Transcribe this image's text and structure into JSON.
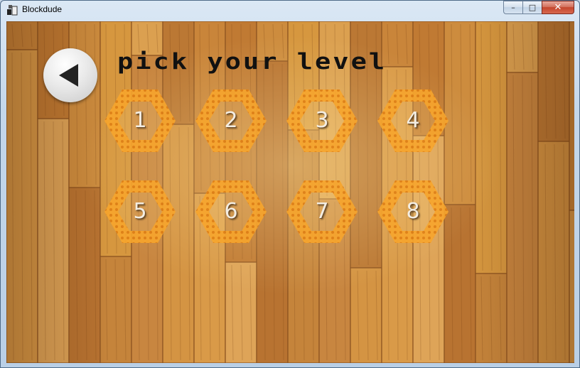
{
  "window": {
    "title": "Blockdude",
    "minimize_glyph": "–",
    "maximize_glyph": "□",
    "close_glyph": "✕"
  },
  "game": {
    "heading": "pick your level",
    "back_icon": "back-arrow-icon",
    "levels": [
      {
        "label": "1"
      },
      {
        "label": "2"
      },
      {
        "label": "3"
      },
      {
        "label": "4"
      },
      {
        "label": "5"
      },
      {
        "label": "6"
      },
      {
        "label": "7"
      },
      {
        "label": "8"
      }
    ]
  },
  "colors": {
    "hex_tile": "#f7a52c",
    "hex_dots": "#e07f14",
    "wood": "#d69a44",
    "heading": "#111111"
  }
}
